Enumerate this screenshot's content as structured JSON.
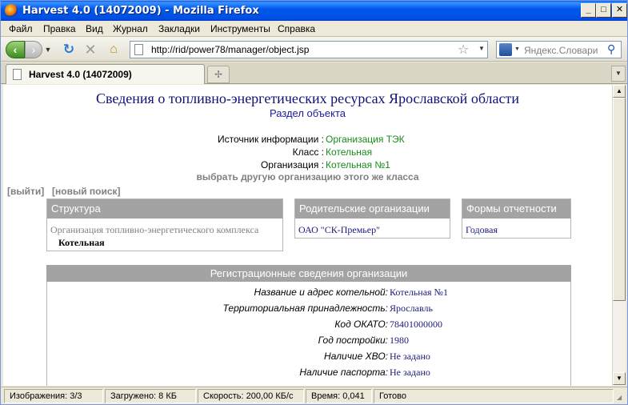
{
  "window": {
    "title": "Harvest 4.0 (14072009) - Mozilla Firefox",
    "minimize": "_",
    "maximize": "□",
    "close": "✕"
  },
  "menu": [
    "Файл",
    "Правка",
    "Вид",
    "Журнал",
    "Закладки",
    "Инструменты",
    "Справка"
  ],
  "nav": {
    "url": "http://rid/power78/manager/object.jsp",
    "search_placeholder": "Яндекс.Словари"
  },
  "tabs": {
    "active_title": "Harvest 4.0 (14072009)"
  },
  "page": {
    "title": "Сведения о топливно-энергетических ресурсах Ярославской области",
    "subtitle": "Раздел объекта",
    "info": [
      {
        "label": "Источник информации :",
        "value": "Организация ТЭК"
      },
      {
        "label": "Класс :",
        "value": "Котельная"
      },
      {
        "label": "Организация :",
        "value": "Котельная №1"
      }
    ],
    "choose_other": "выбрать другую организацию этого же класса",
    "links": {
      "logout": "[выйти]",
      "new_search": "[новый поиск]"
    },
    "structure": {
      "header": "Структура",
      "parent_line": "Организация топливно-энергетического комплекса",
      "current": "Котельная"
    },
    "parents": {
      "header": "Родительские организации",
      "items": [
        "ОАО \"СК-Премьер\""
      ]
    },
    "forms": {
      "header": "Формы отчетности",
      "items": [
        "Годовая"
      ]
    },
    "registration": {
      "header": "Регистрационные сведения организации",
      "rows": [
        {
          "label": "Название и адрес котельной:",
          "value": "Котельная №1"
        },
        {
          "label": "Территориальная принадлежность:",
          "value": "Ярославль"
        },
        {
          "label": "Код ОКАТО:",
          "value": "78401000000"
        },
        {
          "label": "Год постройки:",
          "value": "1980"
        },
        {
          "label": "Наличие ХВО:",
          "value": "Не задано"
        },
        {
          "label": "Наличие паспорта:",
          "value": "Не задано"
        }
      ]
    }
  },
  "status": {
    "images": "Изображения: 3/3",
    "loaded": "Загружено: 8 КБ",
    "speed": "Скорость: 200,00 КБ/с",
    "time": "Время: 0,041",
    "state": "Готово"
  }
}
